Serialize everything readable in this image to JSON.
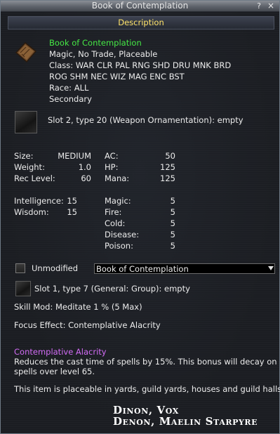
{
  "window": {
    "title": "Book of Contemplation",
    "help_btn": "?",
    "close_btn": "×"
  },
  "section_header": "Description",
  "item": {
    "icon": "book-icon",
    "name": "Book of Contemplation",
    "flags": "Magic, No Trade, Placeable",
    "class_line1": "Class: WAR CLR PAL RNG SHD DRU MNK BRD",
    "class_line2": "ROG SHM NEC WIZ MAG ENC BST",
    "race": "Race: ALL",
    "slot": "Secondary"
  },
  "aug_slot2": "Slot 2, type 20 (Weapon Ornamentation): empty",
  "stats": {
    "size_label": "Size:",
    "size": "MEDIUM",
    "weight_label": "Weight:",
    "weight": "1.0",
    "reclevel_label": "Rec Level:",
    "reclevel": "60",
    "ac_label": "AC:",
    "ac": "50",
    "hp_label": "HP:",
    "hp": "125",
    "mana_label": "Mana:",
    "mana": "125",
    "int_label": "Intelligence:",
    "int": "15",
    "wis_label": "Wisdom:",
    "wis": "15",
    "magic_label": "Magic:",
    "magic": "5",
    "fire_label": "Fire:",
    "fire": "5",
    "cold_label": "Cold:",
    "cold": "5",
    "disease_label": "Disease:",
    "disease": "5",
    "poison_label": "Poison:",
    "poison": "5"
  },
  "unmodified_label": "Unmodified",
  "dropdown_value": "Book of Contemplation",
  "aug_slot1": "Slot 1, type 7 (General: Group): empty",
  "skill_mod": "Skill Mod: Meditate 1 % (5 Max)",
  "focus_effect": "Focus Effect: Contemplative Alacrity",
  "effect": {
    "title": "Contemplative Alacrity",
    "desc_line1": "Reduces the cast time of spells by 15%. This bonus will decay on",
    "desc_line2": "spells over level 65."
  },
  "placeable_note": "This item is placeable in yards, guild yards, houses and guild halls.",
  "signature": {
    "line1": "Dinon, Vox",
    "line2": "Denon, Maelin Starpyre"
  }
}
